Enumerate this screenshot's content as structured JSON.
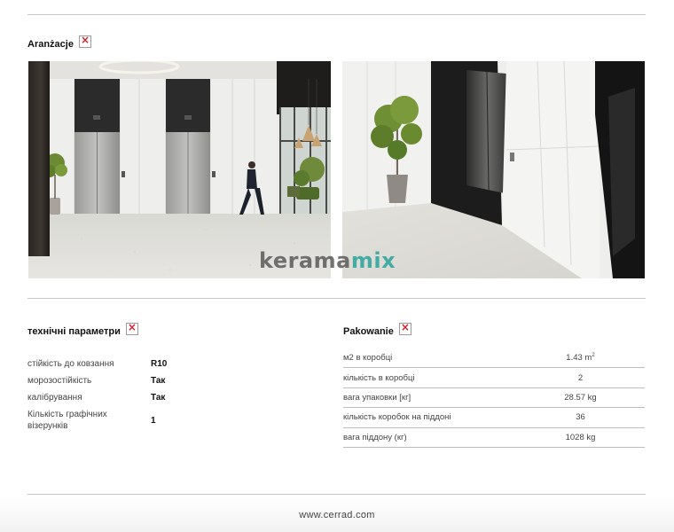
{
  "arrangement": {
    "title": "Aranżacje"
  },
  "watermark": {
    "part1": "kerama",
    "part2": "mix"
  },
  "technical": {
    "title": "технічні параметри",
    "rows": [
      {
        "label": "стійкість до ковзання",
        "value": "R10"
      },
      {
        "label": "морозостійкість",
        "value": "Так"
      },
      {
        "label": "калібрування",
        "value": "Так"
      },
      {
        "label": "Кількість графічних візерунків",
        "value": "1"
      }
    ]
  },
  "packing": {
    "title": "Pakowanie",
    "rows": [
      {
        "label": "м2 в коробці",
        "value": "1.43 m",
        "sup": "2"
      },
      {
        "label": "кількість в коробці",
        "value": "2"
      },
      {
        "label": "вага упаковки [кг]",
        "value": "28.57 kg"
      },
      {
        "label": "кількість коробок на піддоні",
        "value": "36"
      },
      {
        "label": "вага піддону (кг)",
        "value": "1028 kg"
      }
    ]
  },
  "footer": {
    "url": "www.cerrad.com"
  },
  "colors": {
    "accent": "#2aa39b",
    "rule": "#c8c8c8"
  }
}
